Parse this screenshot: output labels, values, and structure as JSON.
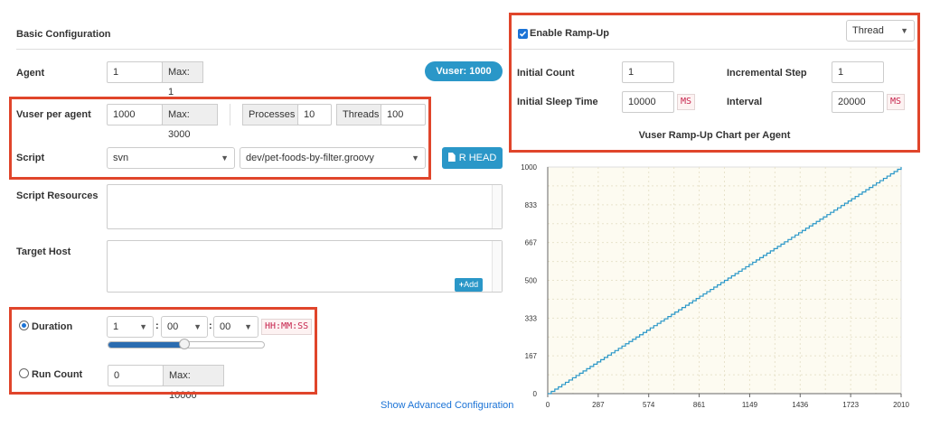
{
  "basic": {
    "title": "Basic Configuration",
    "agent_label": "Agent",
    "agent_value": "1",
    "agent_max": "Max: 1",
    "vuser_badge": "Vuser: 1000",
    "vuser_per_agent_label": "Vuser per agent",
    "vuser_per_agent_value": "1000",
    "vuser_per_agent_max": "Max: 3000",
    "processes_label": "Processes",
    "processes_value": "10",
    "threads_label": "Threads",
    "threads_value": "100",
    "script_label": "Script",
    "script_repo": "svn",
    "script_file": "dev/pet-foods-by-filter.groovy",
    "rhead_button": "R HEAD",
    "script_resources_label": "Script Resources",
    "target_host_label": "Target Host",
    "add_button": "Add",
    "duration_label": "Duration",
    "duration_hours": "1",
    "duration_minutes": "00",
    "duration_seconds": "00",
    "duration_colon": ":",
    "duration_format": "HH:MM:SS",
    "duration_slider_level": 0.49,
    "run_count_label": "Run Count",
    "run_count_value": "0",
    "run_count_max": "Max: 10000",
    "show_advanced": "Show Advanced Configuration"
  },
  "rampup": {
    "enable_label": "Enable Ramp-Up",
    "enabled": true,
    "mode": "Thread",
    "initial_count_label": "Initial Count",
    "initial_count_value": "1",
    "incremental_step_label": "Incremental Step",
    "incremental_step_value": "1",
    "initial_sleep_label": "Initial Sleep Time",
    "initial_sleep_value": "10000",
    "initial_sleep_unit": "MS",
    "interval_label": "Interval",
    "interval_value": "20000",
    "interval_unit": "MS",
    "chart_title": "Vuser Ramp-Up Chart per Agent"
  },
  "colors": {
    "highlight": "#e0452b",
    "badge": "#2a97c8",
    "button": "#2a97c8",
    "slider_fill": "#2b6cb0",
    "link": "#1b73d6",
    "line": "#2a97c8"
  },
  "chart_data": {
    "type": "line",
    "title": "Vuser Ramp-Up Chart per Agent",
    "xlabel": "",
    "ylabel": "",
    "x_ticks": [
      "0",
      "287",
      "574",
      "861",
      "1149",
      "1436",
      "1723",
      "2010"
    ],
    "y_ticks": [
      "0",
      "167",
      "333",
      "500",
      "667",
      "833",
      "1000"
    ],
    "xlim": [
      0,
      2010
    ],
    "ylim": [
      0,
      1000
    ],
    "series": [
      {
        "values_x": [
          0,
          2010
        ],
        "values_y": [
          0,
          1000
        ],
        "step": true
      }
    ]
  }
}
